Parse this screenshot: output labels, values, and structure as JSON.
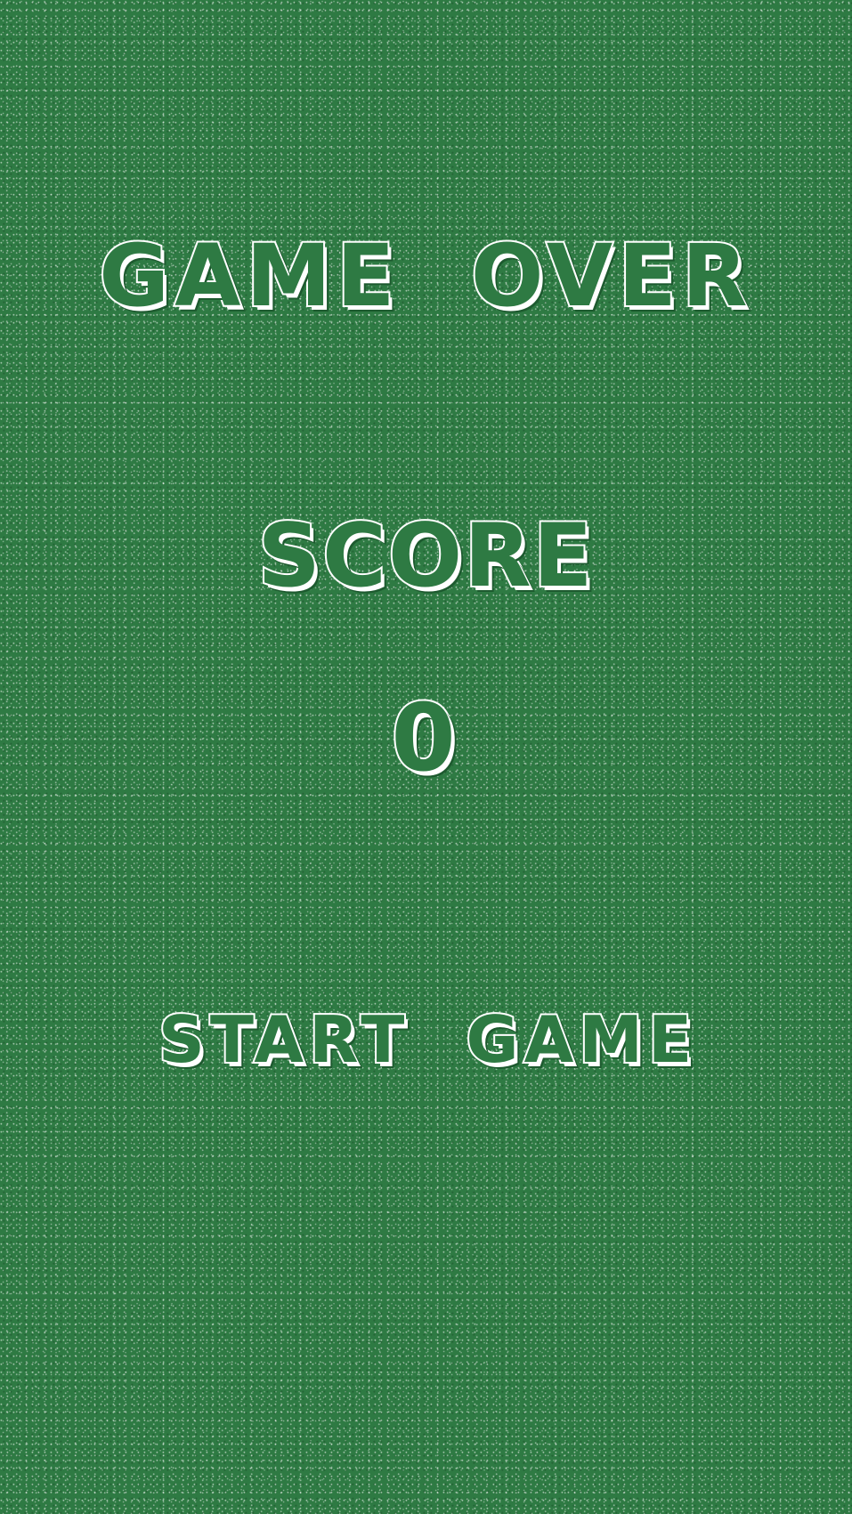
{
  "game_over": {
    "title": "GAME OVER",
    "score_label": "SCORE",
    "score_value": "0",
    "start_button_label": "START GAME"
  },
  "colors": {
    "background": "#2e7a43",
    "text": "#ffffff"
  }
}
